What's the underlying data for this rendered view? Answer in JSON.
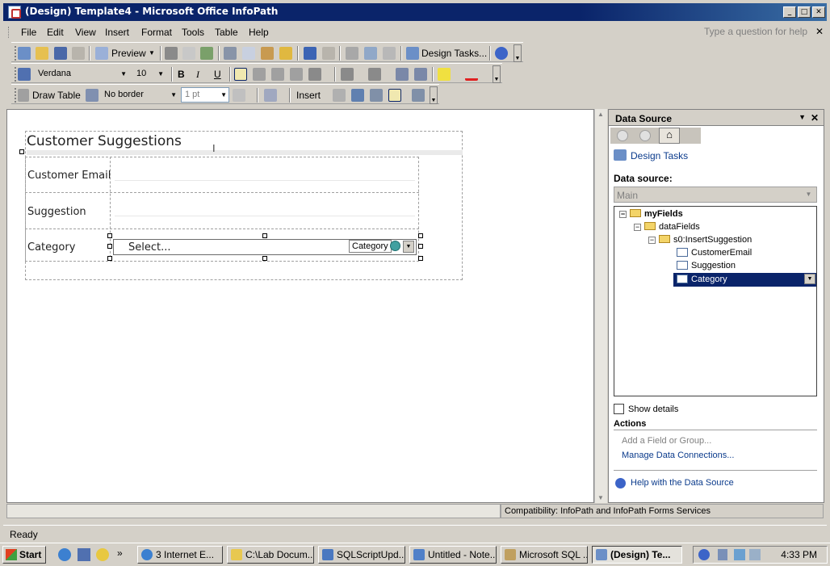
{
  "window": {
    "title": "(Design) Template4 - Microsoft Office InfoPath",
    "minimize": "_",
    "maximize": "□",
    "close": "✕"
  },
  "menu": {
    "items": [
      "File",
      "Edit",
      "View",
      "Insert",
      "Format",
      "Tools",
      "Table",
      "Help"
    ],
    "ask_placeholder": "Type a question for help",
    "close_doc": "✕"
  },
  "toolbar1": {
    "preview_label": "Preview",
    "design_tasks_label": "Design Tasks..."
  },
  "toolbar2": {
    "font": "Verdana",
    "size": "10",
    "bold": "B",
    "italic": "I",
    "underline": "U"
  },
  "toolbar3": {
    "draw_table": "Draw Table",
    "border_style": "No border",
    "border_width": "1 pt",
    "insert": "Insert"
  },
  "form": {
    "title": "Customer Suggestions",
    "rows": [
      {
        "label": "Customer Email"
      },
      {
        "label": "Suggestion"
      },
      {
        "label": "Category"
      }
    ],
    "dropdown_value": "Select...",
    "dropdown_tag": "Category"
  },
  "taskpane": {
    "title": "Data Source",
    "design_tasks_link": "Design Tasks",
    "data_source_label": "Data source:",
    "data_source_value": "Main",
    "tree": [
      {
        "label": "myFields",
        "type": "folder",
        "level": 0,
        "expander": "−"
      },
      {
        "label": "dataFields",
        "type": "folder",
        "level": 1,
        "expander": "−"
      },
      {
        "label": "s0:InsertSuggestion",
        "type": "folder",
        "level": 2,
        "expander": "−"
      },
      {
        "label": "CustomerEmail",
        "type": "field",
        "level": 3
      },
      {
        "label": "Suggestion",
        "type": "field",
        "level": 3
      },
      {
        "label": "Category",
        "type": "field",
        "level": 3,
        "selected": true
      }
    ],
    "show_details": "Show details",
    "actions_heading": "Actions",
    "add_field": "Add a Field or Group...",
    "manage_connections": "Manage Data Connections...",
    "help_link": "Help with the Data Source"
  },
  "status": {
    "compatibility": "Compatibility: InfoPath and InfoPath Forms Services",
    "ready": "Ready"
  },
  "taskbar": {
    "start": "Start",
    "tasks": [
      {
        "label": "3 Internet E...",
        "icon": "ie-icon"
      },
      {
        "label": "C:\\Lab Docum...",
        "icon": "folder-icon"
      },
      {
        "label": "SQLScriptUpd...",
        "icon": "document-icon"
      },
      {
        "label": "Untitled - Note...",
        "icon": "notepad-icon"
      },
      {
        "label": "Microsoft SQL ...",
        "icon": "sql-icon"
      },
      {
        "label": "(Design) Te...",
        "icon": "infopath-icon",
        "active": true
      }
    ],
    "clock": "4:33 PM"
  },
  "colors": {
    "title_bar": "#0a246a",
    "selection": "#0a246a",
    "link": "#0b3b8c"
  }
}
